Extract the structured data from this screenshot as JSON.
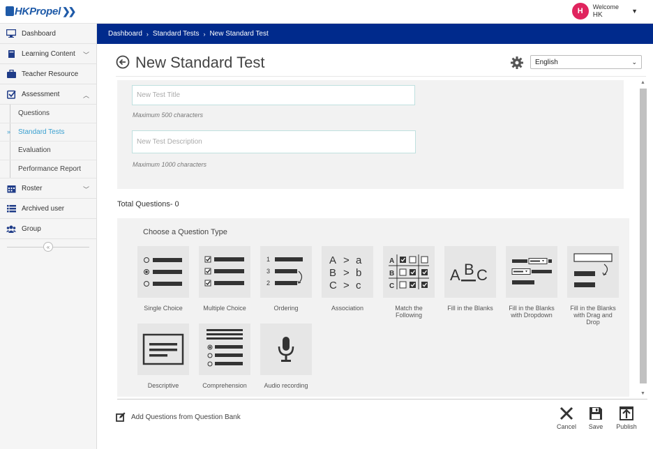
{
  "app": {
    "logo_text": "HKPropel",
    "welcome": "Welcome",
    "user_name": "HK",
    "avatar_initial": "H",
    "brand_color": "#1e5aa8",
    "avatar_color": "#e0245e"
  },
  "sidebar": {
    "items": [
      {
        "label": "Dashboard",
        "icon": "monitor-icon"
      },
      {
        "label": "Learning Content",
        "icon": "book-icon"
      },
      {
        "label": "Teacher Resource",
        "icon": "briefcase-icon"
      },
      {
        "label": "Assessment",
        "icon": "checkbox-icon"
      },
      {
        "label": "Roster",
        "icon": "calendar-icon"
      },
      {
        "label": "Archived user",
        "icon": "list-icon"
      },
      {
        "label": "Group",
        "icon": "group-icon"
      }
    ],
    "assessment_sub": [
      "Questions",
      "Standard Tests",
      "Evaluation",
      "Performance Report"
    ],
    "active_sub": "Standard Tests"
  },
  "breadcrumb": [
    "Dashboard",
    "Standard Tests",
    "New Standard Test"
  ],
  "header": {
    "title": "New Standard Test",
    "language": "English"
  },
  "form": {
    "title_placeholder": "New Test Title",
    "title_hint": "Maximum 500 characters",
    "desc_placeholder": "New Test Description",
    "desc_hint": "Maximum 1000 characters"
  },
  "total_questions": "Total Questions- 0",
  "question_types": {
    "heading": "Choose a Question Type",
    "items": [
      {
        "label": "Single Choice",
        "label2": "",
        "icon": "single-choice-icon"
      },
      {
        "label": "Multiple Choice",
        "label2": "",
        "icon": "multiple-choice-icon"
      },
      {
        "label": "Ordering",
        "label2": "",
        "icon": "ordering-icon"
      },
      {
        "label": "Association",
        "label2": "",
        "icon": "association-icon"
      },
      {
        "label": "Match the",
        "label2": "Following",
        "icon": "match-icon"
      },
      {
        "label": "Fill in the Blanks",
        "label2": "",
        "icon": "fill-blanks-icon"
      },
      {
        "label": "Fill in the Blanks",
        "label2": "with Dropdown",
        "icon": "fill-dropdown-icon"
      },
      {
        "label": "Fill in the Blanks",
        "label2": "with Drag and Drop",
        "icon": "fill-drag-icon"
      },
      {
        "label": "Descriptive",
        "label2": "",
        "icon": "descriptive-icon"
      },
      {
        "label": "Comprehension",
        "label2": "",
        "icon": "comprehension-icon"
      },
      {
        "label": "Audio recording",
        "label2": "",
        "icon": "microphone-icon"
      }
    ],
    "association_glyphs": {
      "row1": [
        "A",
        ">",
        "a"
      ],
      "row2": [
        "B",
        ">",
        "b"
      ],
      "row3": [
        "C",
        ">",
        "c"
      ]
    },
    "ordering_numbers": [
      "1",
      "3",
      "2"
    ],
    "match_letters": [
      "A",
      "B",
      "C"
    ],
    "abc_glyph": {
      "a": "A",
      "b": "B",
      "c": "C"
    }
  },
  "footer": {
    "add_from_bank": "Add Questions from Question Bank",
    "cancel": "Cancel",
    "save": "Save",
    "publish": "Publish"
  }
}
